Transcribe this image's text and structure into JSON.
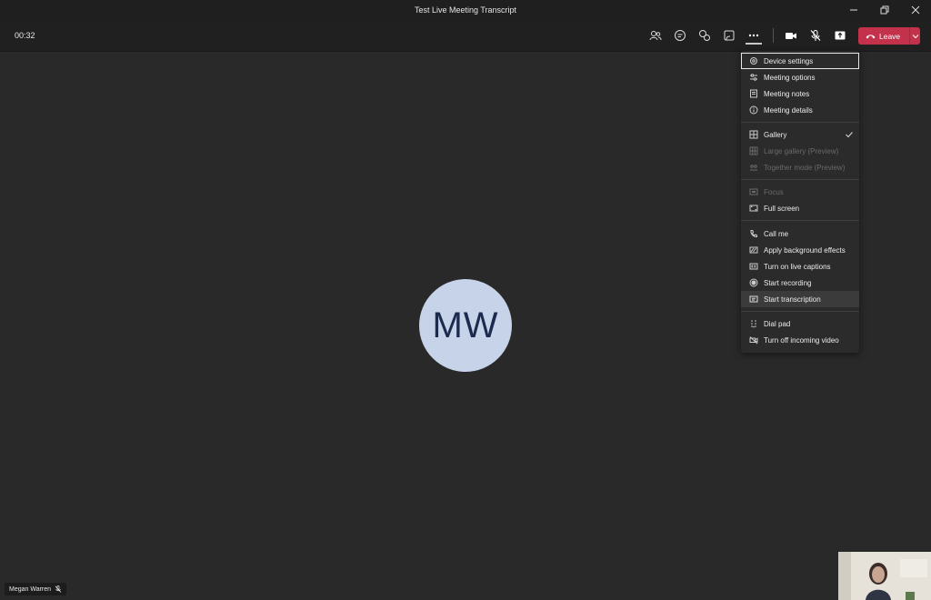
{
  "window": {
    "title": "Test Live Meeting Transcript"
  },
  "toolbar": {
    "timer": "00:32",
    "leave_label": "Leave",
    "icons": [
      "people-icon",
      "chat-icon",
      "reactions-icon",
      "share-tray-icon",
      "more-icon",
      "camera-icon",
      "mic-off-icon",
      "share-screen-icon"
    ]
  },
  "participant": {
    "initials": "MW",
    "name": "Megan Warren"
  },
  "menu": {
    "items": [
      {
        "label": "Device settings",
        "icon": "gear-icon",
        "state": "focused"
      },
      {
        "label": "Meeting options",
        "icon": "sliders-icon",
        "state": "normal"
      },
      {
        "label": "Meeting notes",
        "icon": "notes-icon",
        "state": "normal"
      },
      {
        "label": "Meeting details",
        "icon": "info-icon",
        "state": "normal"
      },
      {
        "label": "Gallery",
        "icon": "gallery-icon",
        "state": "checked"
      },
      {
        "label": "Large gallery (Preview)",
        "icon": "large-gallery-icon",
        "state": "disabled"
      },
      {
        "label": "Together mode (Preview)",
        "icon": "together-mode-icon",
        "state": "disabled"
      },
      {
        "label": "Focus",
        "icon": "focus-icon",
        "state": "disabled"
      },
      {
        "label": "Full screen",
        "icon": "fullscreen-icon",
        "state": "normal"
      },
      {
        "label": "Call me",
        "icon": "phone-icon",
        "state": "normal"
      },
      {
        "label": "Apply background effects",
        "icon": "background-effects-icon",
        "state": "normal"
      },
      {
        "label": "Turn on live captions",
        "icon": "captions-icon",
        "state": "normal"
      },
      {
        "label": "Start recording",
        "icon": "record-icon",
        "state": "normal"
      },
      {
        "label": "Start transcription",
        "icon": "transcription-icon",
        "state": "hover"
      },
      {
        "label": "Dial pad",
        "icon": "dialpad-icon",
        "state": "normal"
      },
      {
        "label": "Turn off incoming video",
        "icon": "video-off-icon",
        "state": "normal"
      }
    ]
  },
  "colors": {
    "leave": "#c4314b",
    "avatar_bg": "#c7d3e8",
    "avatar_text": "#1b2a4e",
    "stage_bg": "#292929"
  }
}
